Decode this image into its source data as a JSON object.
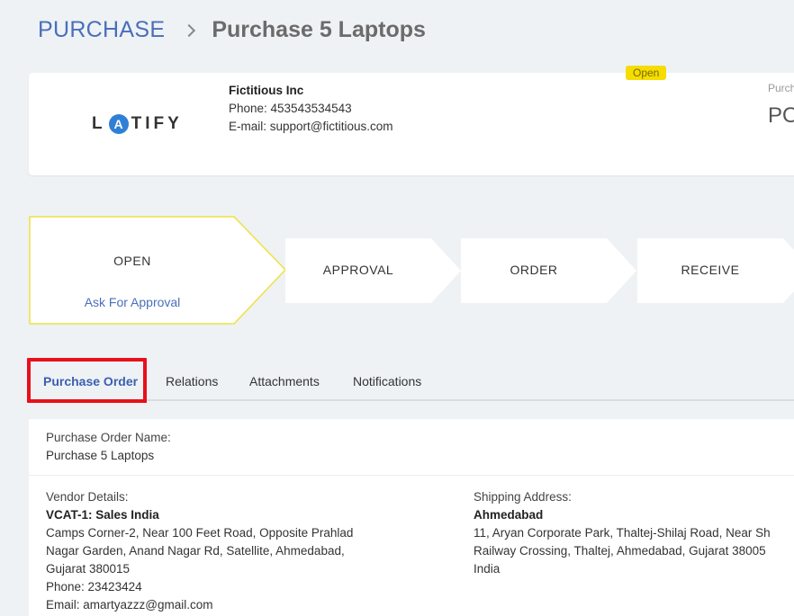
{
  "breadcrumb": {
    "root": "PURCHASE",
    "current": "Purchase 5 Laptops"
  },
  "header": {
    "logo_text": "LATIFY",
    "company_name": "Fictitious Inc",
    "phone": "Phone: 453543534543",
    "email": "E-mail: support@fictitious.com",
    "status": "Open",
    "po_label": "Purch",
    "po_number": "PO"
  },
  "stages": [
    {
      "label": "OPEN",
      "action": "Ask For Approval",
      "active": true
    },
    {
      "label": "APPROVAL"
    },
    {
      "label": "ORDER"
    },
    {
      "label": "RECEIVE"
    }
  ],
  "tabs": [
    {
      "label": "Purchase Order",
      "active": true
    },
    {
      "label": "Relations"
    },
    {
      "label": "Attachments"
    },
    {
      "label": "Notifications"
    }
  ],
  "purchase_order": {
    "name_label": "Purchase Order Name:",
    "name_value": "Purchase 5 Laptops",
    "vendor_label": "Vendor Details:",
    "vendor_name": "VCAT-1: Sales India",
    "vendor_address_1": "Camps Corner-2, Near 100 Feet Road, Opposite Prahlad",
    "vendor_address_2": "Nagar Garden, Anand Nagar Rd, Satellite, Ahmedabad,",
    "vendor_address_3": "Gujarat 380015",
    "vendor_phone": "Phone: 23423424",
    "vendor_email": "Email: amartyazzz@gmail.com",
    "shipping_label": "Shipping Address:",
    "shipping_city": "Ahmedabad",
    "shipping_address_1": "11, Aryan Corporate Park, Thaltej-Shilaj Road, Near Sh",
    "shipping_address_2": "Railway Crossing, Thaltej, Ahmedabad, Gujarat 38005",
    "shipping_address_3": "India"
  },
  "colors": {
    "accent": "#3b5fb0",
    "status_yellow": "#f5dd00",
    "highlight_red": "#e8101a",
    "stage_active_border": "#f0e040"
  }
}
